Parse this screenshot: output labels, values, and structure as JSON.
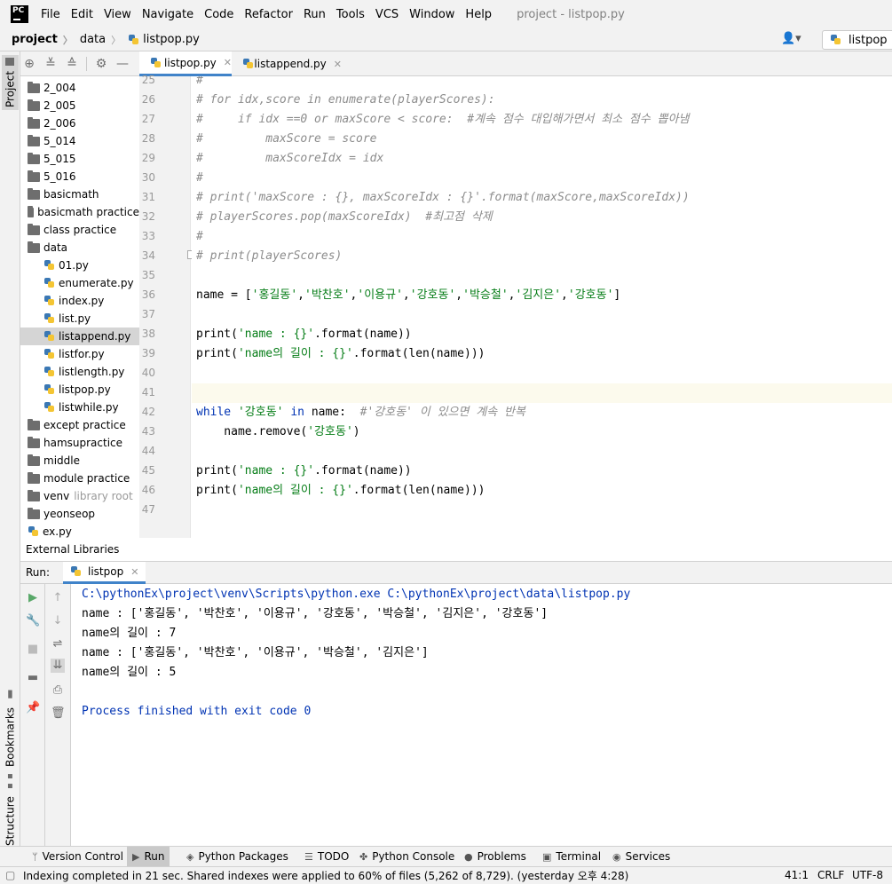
{
  "menubar": {
    "logo": "PC",
    "items": [
      "File",
      "Edit",
      "View",
      "Navigate",
      "Code",
      "Refactor",
      "Run",
      "Tools",
      "VCS",
      "Window",
      "Help"
    ],
    "title": "project - listpop.py"
  },
  "navbar": {
    "crumbs": [
      "project",
      "data",
      "listpop.py"
    ],
    "run_config": "listpop"
  },
  "left_stripe": {
    "project": "Project",
    "bookmarks": "Bookmarks",
    "structure": "Structure"
  },
  "tree": [
    {
      "label": "2_004",
      "type": "folder",
      "indent": 0
    },
    {
      "label": "2_005",
      "type": "folder",
      "indent": 0
    },
    {
      "label": "2_006",
      "type": "folder",
      "indent": 0
    },
    {
      "label": "5_014",
      "type": "folder",
      "indent": 0
    },
    {
      "label": "5_015",
      "type": "folder",
      "indent": 0
    },
    {
      "label": "5_016",
      "type": "folder",
      "indent": 0
    },
    {
      "label": "basicmath",
      "type": "folder",
      "indent": 0
    },
    {
      "label": "basicmath practice",
      "type": "folder",
      "indent": 0
    },
    {
      "label": "class practice",
      "type": "folder",
      "indent": 0
    },
    {
      "label": "data",
      "type": "folder",
      "indent": 0
    },
    {
      "label": "01.py",
      "type": "py",
      "indent": 1
    },
    {
      "label": "enumerate.py",
      "type": "py",
      "indent": 1
    },
    {
      "label": "index.py",
      "type": "py",
      "indent": 1
    },
    {
      "label": "list.py",
      "type": "py",
      "indent": 1
    },
    {
      "label": "listappend.py",
      "type": "py",
      "indent": 1,
      "selected": true
    },
    {
      "label": "listfor.py",
      "type": "py",
      "indent": 1
    },
    {
      "label": "listlength.py",
      "type": "py",
      "indent": 1
    },
    {
      "label": "listpop.py",
      "type": "py",
      "indent": 1
    },
    {
      "label": "listwhile.py",
      "type": "py",
      "indent": 1
    },
    {
      "label": "except practice",
      "type": "folder",
      "indent": 0
    },
    {
      "label": "hamsupractice",
      "type": "folder",
      "indent": 0
    },
    {
      "label": "middle",
      "type": "folder",
      "indent": 0
    },
    {
      "label": "module practice",
      "type": "folder",
      "indent": 0
    },
    {
      "label": "venv",
      "type": "folder",
      "indent": 0,
      "suffix": "library root"
    },
    {
      "label": "yeonseop",
      "type": "folder",
      "indent": 0
    },
    {
      "label": "ex.py",
      "type": "py",
      "indent": 0
    },
    {
      "label": "External Libraries",
      "type": "lib",
      "indent": 0
    }
  ],
  "editor_tabs": [
    {
      "label": "listpop.py",
      "active": true
    },
    {
      "label": "listappend.py",
      "active": false
    }
  ],
  "code": {
    "line_numbers": [
      "25",
      "26",
      "27",
      "28",
      "29",
      "30",
      "31",
      "32",
      "33",
      "34",
      "35",
      "36",
      "37",
      "38",
      "39",
      "40",
      "41",
      "42",
      "43",
      "44",
      "45",
      "46",
      "47"
    ],
    "caret_line": "41",
    "lines": [
      [
        {
          "t": "#",
          "c": "cmt"
        }
      ],
      [
        {
          "t": "# for idx,score in enumerate(playerScores):",
          "c": "cmt"
        }
      ],
      [
        {
          "t": "#     if idx ==0 or maxScore < score:  #계속 점수 대입해가면서 최소 점수 뽑아냄",
          "c": "cmt"
        }
      ],
      [
        {
          "t": "#         maxScore = score",
          "c": "cmt"
        }
      ],
      [
        {
          "t": "#         maxScoreIdx = idx",
          "c": "cmt"
        }
      ],
      [
        {
          "t": "#",
          "c": "cmt"
        }
      ],
      [
        {
          "t": "# print('maxScore : {}, maxScoreIdx : {}'.format(maxScore,maxScoreIdx))",
          "c": "cmt"
        }
      ],
      [
        {
          "t": "# playerScores.pop(maxScoreIdx)  #최고점 삭제",
          "c": "cmt"
        }
      ],
      [
        {
          "t": "#",
          "c": "cmt"
        }
      ],
      [
        {
          "t": "# print(playerScores)",
          "c": "cmt"
        }
      ],
      [],
      [
        {
          "t": "name = [",
          "c": "fn"
        },
        {
          "t": "'홍길동'",
          "c": "str"
        },
        {
          "t": ",",
          "c": "fn"
        },
        {
          "t": "'박찬호'",
          "c": "str"
        },
        {
          "t": ",",
          "c": "fn"
        },
        {
          "t": "'이용규'",
          "c": "str"
        },
        {
          "t": ",",
          "c": "fn"
        },
        {
          "t": "'강호동'",
          "c": "str"
        },
        {
          "t": ",",
          "c": "fn"
        },
        {
          "t": "'박승철'",
          "c": "str"
        },
        {
          "t": ",",
          "c": "fn"
        },
        {
          "t": "'김지은'",
          "c": "str"
        },
        {
          "t": ",",
          "c": "fn"
        },
        {
          "t": "'강호동'",
          "c": "str"
        },
        {
          "t": "]",
          "c": "fn"
        }
      ],
      [],
      [
        {
          "t": "print(",
          "c": "fn"
        },
        {
          "t": "'name : {}'",
          "c": "str"
        },
        {
          "t": ".format(name))",
          "c": "fn"
        }
      ],
      [
        {
          "t": "print(",
          "c": "fn"
        },
        {
          "t": "'name의 길이 : {}'",
          "c": "str"
        },
        {
          "t": ".format(len(name)))",
          "c": "fn"
        }
      ],
      [],
      [],
      [
        {
          "t": "while ",
          "c": "kw"
        },
        {
          "t": "'강호동' ",
          "c": "str"
        },
        {
          "t": "in ",
          "c": "kw"
        },
        {
          "t": "name:  ",
          "c": "fn"
        },
        {
          "t": "#'강호동' 이 있으면 계속 반복",
          "c": "cmt"
        }
      ],
      [
        {
          "t": "    name.remove(",
          "c": "fn"
        },
        {
          "t": "'강호동'",
          "c": "str"
        },
        {
          "t": ")",
          "c": "fn"
        }
      ],
      [],
      [
        {
          "t": "print(",
          "c": "fn"
        },
        {
          "t": "'name : {}'",
          "c": "str"
        },
        {
          "t": ".format(name))",
          "c": "fn"
        }
      ],
      [
        {
          "t": "print(",
          "c": "fn"
        },
        {
          "t": "'name의 길이 : {}'",
          "c": "str"
        },
        {
          "t": ".format(len(name)))",
          "c": "fn"
        }
      ],
      []
    ]
  },
  "run": {
    "label": "Run:",
    "tab": "listpop",
    "output": [
      "C:\\pythonEx\\project\\venv\\Scripts\\python.exe C:\\pythonEx\\project\\data\\listpop.py",
      "name : ['홍길동', '박찬호', '이용규', '강호동', '박승철', '김지은', '강호동']",
      "name의 길이 : 7",
      "name : ['홍길동', '박찬호', '이용규', '박승철', '김지은']",
      "name의 길이 : 5",
      "",
      "Process finished with exit code 0"
    ],
    "output_colors": [
      "#0033b3",
      "#000000",
      "#000000",
      "#000000",
      "#000000",
      "#000000",
      "#0033b3"
    ]
  },
  "toolwindows": [
    {
      "label": "Version Control",
      "icon": "version-control-icon",
      "glyph": "ᛘ",
      "active": false
    },
    {
      "label": "Run",
      "icon": "run-icon",
      "glyph": "▶",
      "active": true
    },
    {
      "label": "Python Packages",
      "icon": "packages-icon",
      "glyph": "◈",
      "active": false
    },
    {
      "label": "TODO",
      "icon": "todo-icon",
      "glyph": "☰",
      "active": false
    },
    {
      "label": "Python Console",
      "icon": "python-console-icon",
      "glyph": "✤",
      "active": false
    },
    {
      "label": "Problems",
      "icon": "problems-icon",
      "glyph": "●",
      "active": false
    },
    {
      "label": "Terminal",
      "icon": "terminal-icon",
      "glyph": "▣",
      "active": false
    },
    {
      "label": "Services",
      "icon": "services-icon",
      "glyph": "◉",
      "active": false
    }
  ],
  "status": {
    "message": "Indexing completed in 21 sec. Shared indexes were applied to 60% of files (5,262 of 8,729). (yesterday 오후 4:28)",
    "position": "41:1",
    "line_sep": "CRLF",
    "encoding": "UTF-8"
  },
  "colors": {
    "accent": "#4083c9",
    "keyword": "#0033b3",
    "string": "#067d17",
    "comment": "#8c8c8c",
    "run_green": "#59a869"
  }
}
